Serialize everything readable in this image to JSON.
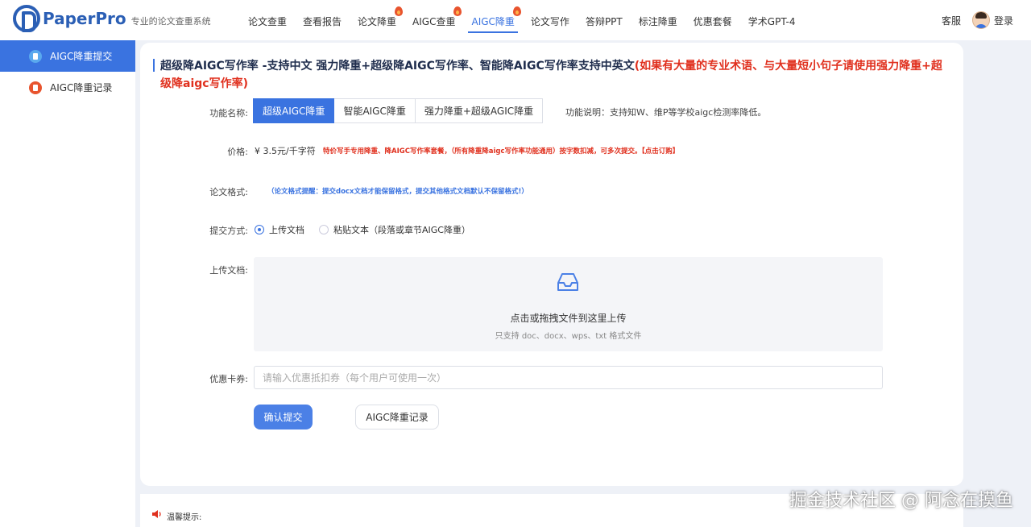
{
  "header": {
    "logo_text": "PaperPro",
    "logo_sub": "专业的论文查重系统",
    "nav": [
      {
        "label": "论文查重"
      },
      {
        "label": "查看报告"
      },
      {
        "label": "论文降重"
      },
      {
        "label": "AIGC查重"
      },
      {
        "label": "AIGC降重"
      },
      {
        "label": "论文写作"
      },
      {
        "label": "答辩PPT"
      },
      {
        "label": "标注降重"
      },
      {
        "label": "优惠套餐"
      },
      {
        "label": "学术GPT-4"
      }
    ],
    "service": "客服",
    "login": "登录"
  },
  "sidebar": {
    "items": [
      {
        "label": "AIGC降重提交"
      },
      {
        "label": "AIGC降重记录"
      }
    ]
  },
  "main": {
    "title": "超级降AIGC写作率 -支持中文   强力降重+超级降AIGC写作率、智能降AIGC写作率支持中英文",
    "title_warning": "(如果有大量的专业术语、与大量短小句子请使用强力降重+超级降aigc写作率)",
    "function_label": "功能名称:",
    "tabs": [
      {
        "label": "超级AIGC降重"
      },
      {
        "label": "智能AIGC降重"
      },
      {
        "label": "强力降重+超级AGIC降重"
      }
    ],
    "function_desc": "功能说明：支持知W、维P等学校aigc检测率降低。",
    "price_label": "价格:",
    "price": "¥ 3.5元/千字符",
    "price_note": "特价写手专用降重、降AIGC写作率套餐，（所有降重降aigc写作率功能通用）按字数扣减，可多次提交。【点击订购】",
    "format_label": "论文格式:",
    "format_note": "（论文格式提醒：提交docx文档才能保留格式，提交其他格式文档默认不保留格式!）",
    "submit_label": "提交方式:",
    "submit_options": [
      {
        "label": "上传文档"
      },
      {
        "label": "粘贴文本（段落或章节AIGC降重）"
      }
    ],
    "upload_label": "上传文档:",
    "upload_main": "点击或拖拽文件到这里上传",
    "upload_sub": "只支持 doc、docx、wps、txt 格式文件",
    "coupon_label": "优惠卡券:",
    "coupon_placeholder": "请输入优惠抵扣券（每个用户可使用一次）",
    "confirm_button": "确认提交",
    "record_button": "AIGC降重记录"
  },
  "tips": {
    "label": "温馨提示:"
  },
  "watermark": "掘金技术社区 @ 阿念在摸鱼",
  "colors": {
    "accent": "#3a73e0",
    "warning": "#e0301e"
  }
}
